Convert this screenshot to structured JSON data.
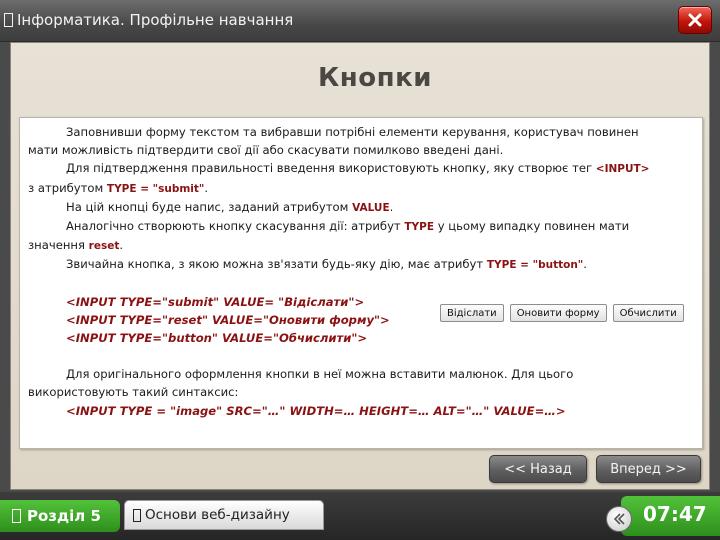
{
  "window": {
    "title": "Інформатика. Профільне навчання"
  },
  "slide": {
    "heading": "Кнопки",
    "lines": {
      "p1a": "Заповнивши форму текстом та вибравши потрібні елементи керування, користувач повинен",
      "p1b": "мати можливість підтвердити свої дії або скасувати помилково введені дані.",
      "p2a": "Для підтвердження правильності введення використовують кнопку, яку створює тег ",
      "p2a_kw": "<INPUT>",
      "p2b_pre": "з атрибутом ",
      "p2b_kw": "TYPE = \"submit\"",
      "p2b_post": ".",
      "p3_pre": "На цій кнопці буде напис, заданий атрибутом ",
      "p3_kw": "VALUE",
      "p3_post": ".",
      "p4a_pre": "Аналогічно створюють кнопку скасування дії: атрибут ",
      "p4a_kw": "TYPE",
      "p4a_post": " у цьому випадку повинен мати",
      "p4b_pre": "значення ",
      "p4b_kw": "reset",
      "p4b_post": ".",
      "p5_pre": "Звичайна кнопка, з якою можна зв'язати будь-яку дію, має атрибут ",
      "p5_kw": "TYPE = \"button\"",
      "p5_post": ".",
      "code1": "<INPUT  TYPE=\"submit\"  VALUE= \"Відіслати\">",
      "code2": "<INPUT  TYPE=\"reset\"  VALUE=\"Оновити  форму\">",
      "code3": "<INPUT  TYPE=\"button\"   VALUE=\"Обчислити\">",
      "p6a": "Для оригінального оформлення кнопки в неї можна вставити малюнок. Для цього",
      "p6b": "використовують такий синтаксис:",
      "code4": "<INPUT TYPE = \"image\" SRC=\"…\" WIDTH=… HEIGHT=… ALT=\"…\" VALUE=…>"
    },
    "demo_buttons": {
      "submit": "Відіслати",
      "reset": "Оновити  форму",
      "button": "Обчислити"
    },
    "nav": {
      "back": "<< Назад",
      "forward": "Вперед >>"
    }
  },
  "footer": {
    "section_label": "Розділ 5",
    "course_label": "Основи веб-дизайну",
    "time": "07:47"
  },
  "icons": {
    "close": "close-icon",
    "nav": "chevron-left-icon"
  },
  "colors": {
    "accent_green": "#3fae2a",
    "close_red": "#c3140a",
    "keyword_red": "#8b1212"
  }
}
